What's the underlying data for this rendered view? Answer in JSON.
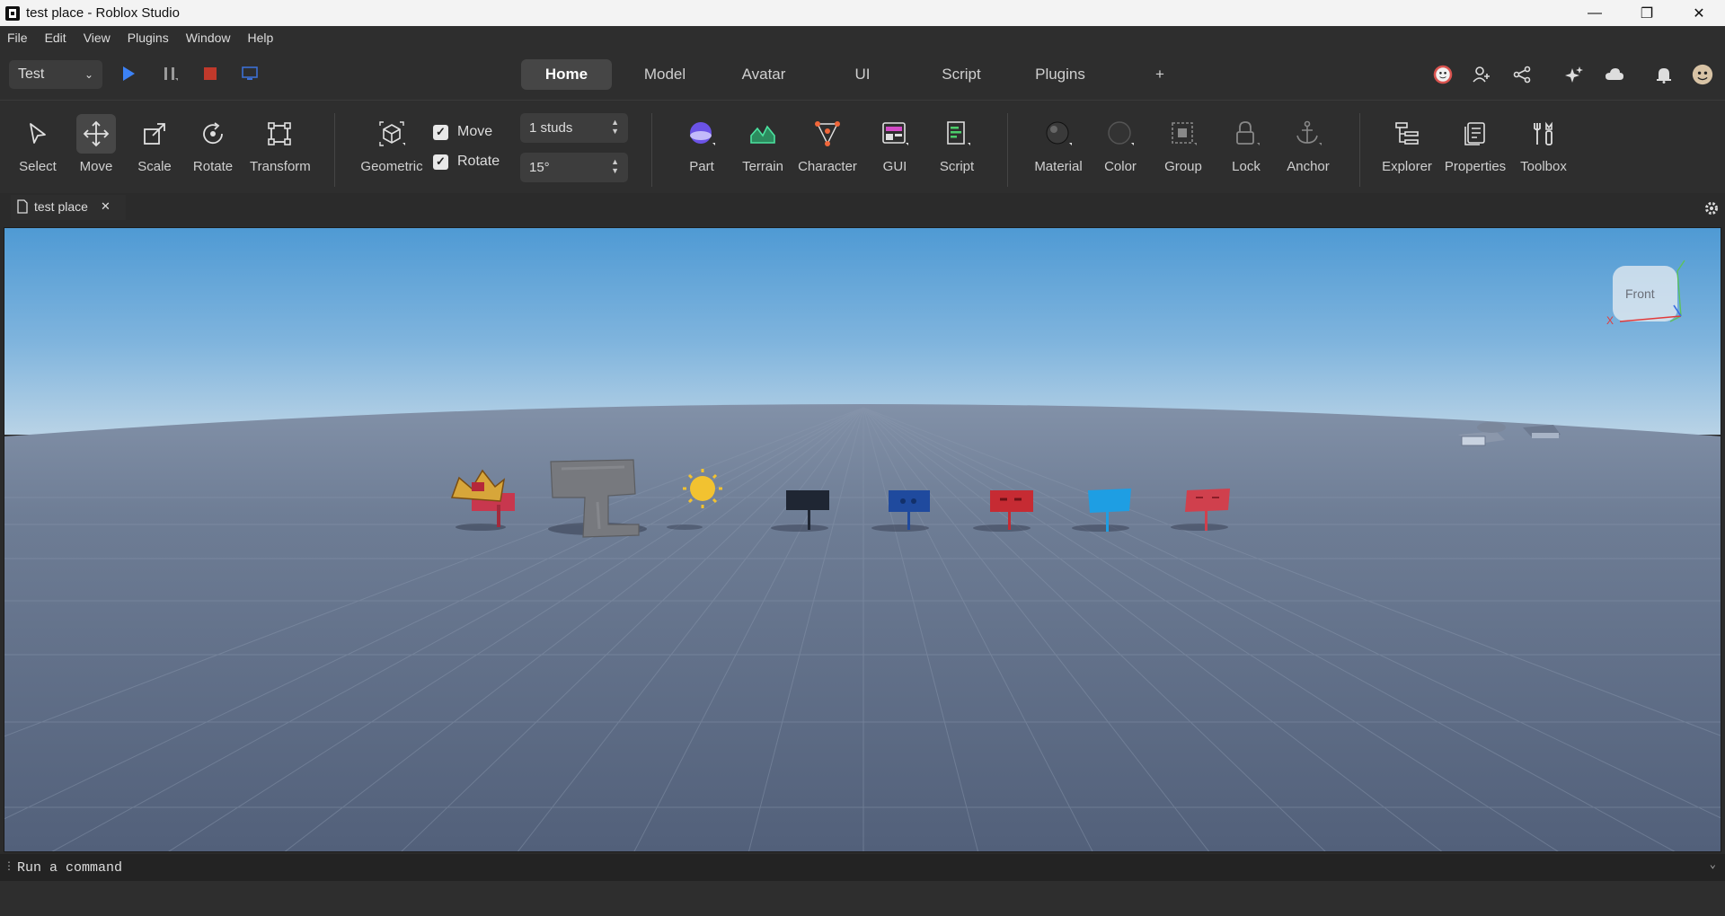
{
  "window": {
    "title": "test place - Roblox Studio"
  },
  "menu": [
    "File",
    "Edit",
    "View",
    "Plugins",
    "Window",
    "Help"
  ],
  "topbar": {
    "mode": "Test",
    "tabs": [
      "Home",
      "Model",
      "Avatar",
      "UI",
      "Script",
      "Plugins",
      "+"
    ],
    "active_tab": "Home"
  },
  "ribbon": {
    "tools": [
      {
        "label": "Select",
        "icon": "cursor-icon"
      },
      {
        "label": "Move",
        "icon": "move-arrows-icon",
        "active": true
      },
      {
        "label": "Scale",
        "icon": "scale-icon"
      },
      {
        "label": "Rotate",
        "icon": "rotate-icon"
      },
      {
        "label": "Transform",
        "icon": "transform-icon"
      }
    ],
    "geometric_label": "Geometric",
    "snap_move_label": "Move",
    "snap_rotate_label": "Rotate",
    "move_increment": "1 studs",
    "rotate_increment": "15°",
    "insert_tools": [
      {
        "label": "Part",
        "icon": "part-sphere-icon"
      },
      {
        "label": "Terrain",
        "icon": "terrain-icon"
      },
      {
        "label": "Character",
        "icon": "character-icon"
      },
      {
        "label": "GUI",
        "icon": "gui-icon"
      },
      {
        "label": "Script",
        "icon": "script-icon"
      }
    ],
    "edit_tools": [
      {
        "label": "Material",
        "icon": "material-icon"
      },
      {
        "label": "Color",
        "icon": "color-icon"
      },
      {
        "label": "Group",
        "icon": "group-icon"
      },
      {
        "label": "Lock",
        "icon": "lock-icon"
      },
      {
        "label": "Anchor",
        "icon": "anchor-icon"
      }
    ],
    "panel_tools": [
      {
        "label": "Explorer",
        "icon": "explorer-icon"
      },
      {
        "label": "Properties",
        "icon": "properties-icon"
      },
      {
        "label": "Toolbox",
        "icon": "toolbox-icon"
      }
    ]
  },
  "document_tab": "test place",
  "viewport": {
    "view_cube_label": "Front",
    "axis_x_label": "X",
    "sky_top": "#4f9ad4",
    "sky_horizon": "#b9d3e6",
    "ground": "#5d6b82"
  },
  "command_bar": {
    "placeholder": "Run a command"
  }
}
